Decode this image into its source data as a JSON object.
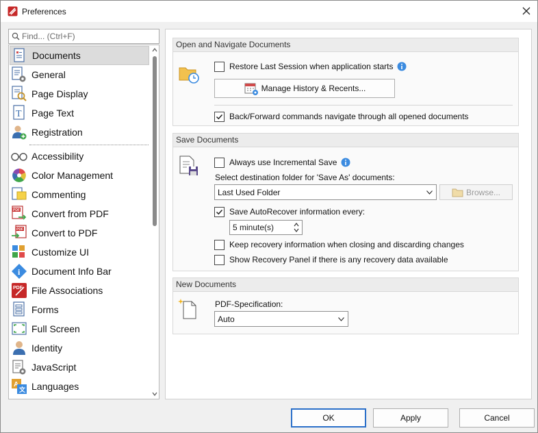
{
  "window": {
    "title": "Preferences"
  },
  "search": {
    "placeholder": "Find... (Ctrl+F)",
    "value": ""
  },
  "nav": {
    "items": [
      {
        "label": "Documents",
        "icon": "documents-icon",
        "selected": true
      },
      {
        "label": "General",
        "icon": "general-icon"
      },
      {
        "label": "Page Display",
        "icon": "page-display-icon"
      },
      {
        "label": "Page Text",
        "icon": "page-text-icon"
      },
      {
        "label": "Registration",
        "icon": "registration-icon"
      },
      {
        "label": "Accessibility",
        "icon": "accessibility-icon"
      },
      {
        "label": "Color Management",
        "icon": "color-management-icon"
      },
      {
        "label": "Commenting",
        "icon": "commenting-icon"
      },
      {
        "label": "Convert from PDF",
        "icon": "convert-from-pdf-icon"
      },
      {
        "label": "Convert to PDF",
        "icon": "convert-to-pdf-icon"
      },
      {
        "label": "Customize UI",
        "icon": "customize-ui-icon"
      },
      {
        "label": "Document Info Bar",
        "icon": "document-info-bar-icon"
      },
      {
        "label": "File Associations",
        "icon": "file-associations-icon"
      },
      {
        "label": "Forms",
        "icon": "forms-icon"
      },
      {
        "label": "Full Screen",
        "icon": "full-screen-icon"
      },
      {
        "label": "Identity",
        "icon": "identity-icon"
      },
      {
        "label": "JavaScript",
        "icon": "javascript-icon"
      },
      {
        "label": "Languages",
        "icon": "languages-icon"
      }
    ]
  },
  "open_navigate": {
    "title": "Open and Navigate Documents",
    "restore_session": {
      "label": "Restore Last Session when application starts",
      "checked": false
    },
    "manage_history_label": "Manage History & Recents...",
    "back_forward": {
      "label": "Back/Forward commands navigate through all opened documents",
      "checked": true
    }
  },
  "save_docs": {
    "title": "Save Documents",
    "incremental": {
      "label": "Always use Incremental Save",
      "checked": false
    },
    "dest_folder_label": "Select destination folder for 'Save As' documents:",
    "dest_folder_value": "Last Used Folder",
    "browse_label": "Browse...",
    "autorecover": {
      "label": "Save AutoRecover information every:",
      "checked": true
    },
    "autorecover_interval": "5 minute(s)",
    "keep_recovery": {
      "label": "Keep recovery information when closing and discarding changes",
      "checked": false
    },
    "show_recovery": {
      "label": "Show Recovery Panel if there is any recovery data available",
      "checked": false
    }
  },
  "new_docs": {
    "title": "New Documents",
    "pdf_spec_label": "PDF-Specification:",
    "pdf_spec_value": "Auto"
  },
  "footer": {
    "ok": "OK",
    "apply": "Apply",
    "cancel": "Cancel"
  },
  "colors": {
    "accent": "#2a6fc9",
    "info": "#3b8be0",
    "selected_bg": "#dcdcdc"
  }
}
